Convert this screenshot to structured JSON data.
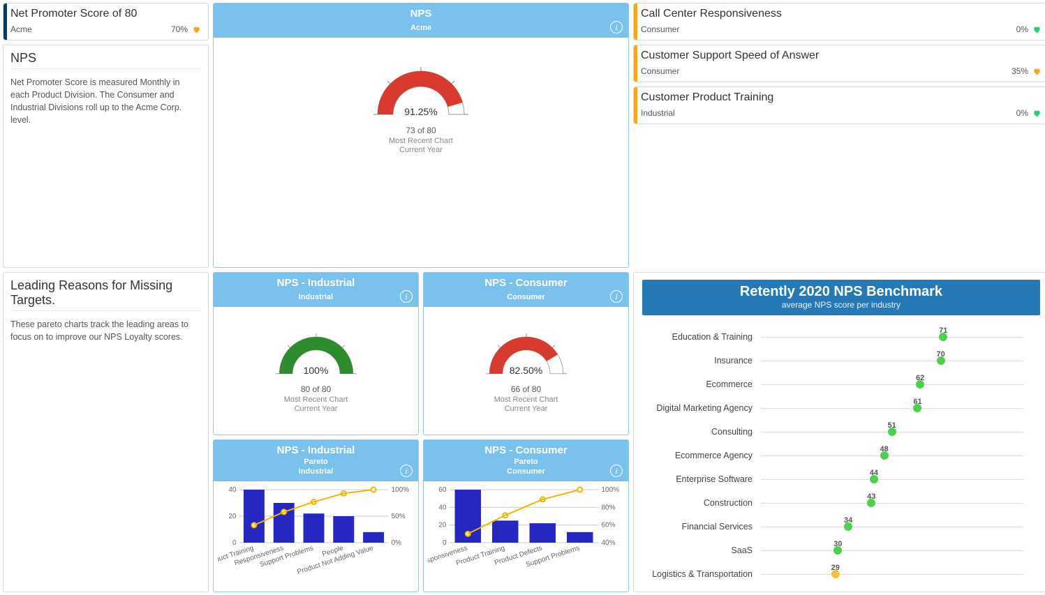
{
  "left": {
    "nps_card": {
      "title": "Net Promoter Score of 80",
      "sub": "Acme",
      "pct": "70%",
      "heart_color": "#f5a623"
    },
    "nps_text": {
      "heading": "NPS",
      "body": "Net Promoter Score is measured Monthly in each Product Division. The Consumer and Industrial Divisions roll up to the Acme Corp. level."
    },
    "reasons_text": {
      "heading": "Leading Reasons for Missing Targets.",
      "body": "These pareto charts track the leading areas to focus on to improve our NPS Loyalty scores."
    }
  },
  "center": {
    "nps_main": {
      "title": "NPS",
      "sub": "Acme",
      "gauge_pct": "91.25%",
      "of_text": "73 of 80",
      "line1": "Most Recent Chart",
      "line2": "Current Year",
      "color": "#d83a2f",
      "value": 91.25
    },
    "nps_ind": {
      "title": "NPS - Industrial",
      "sub": "Industrial",
      "gauge_pct": "100%",
      "of_text": "80 of 80",
      "line1": "Most Recent Chart",
      "line2": "Current Year",
      "color": "#2e8b2e",
      "value": 100
    },
    "nps_con": {
      "title": "NPS - Consumer",
      "sub": "Consumer",
      "gauge_pct": "82.50%",
      "of_text": "66 of 80",
      "line1": "Most Recent Chart",
      "line2": "Current Year",
      "color": "#d83a2f",
      "value": 82.5
    },
    "pareto_ind": {
      "title": "NPS - Industrial",
      "sub1": "Pareto",
      "sub2": "Industrial"
    },
    "pareto_con": {
      "title": "NPS - Consumer",
      "sub1": "Pareto",
      "sub2": "Consumer"
    }
  },
  "right": {
    "cards": [
      {
        "title": "Call Center Responsiveness",
        "sub": "Consumer",
        "pct": "0%",
        "heart_color": "#2ecc71"
      },
      {
        "title": "Customer Support Speed of Answer",
        "sub": "Consumer",
        "pct": "35%",
        "heart_color": "#f5a623"
      },
      {
        "title": "Customer Product Training",
        "sub": "Industrial",
        "pct": "0%",
        "heart_color": "#2ecc71"
      }
    ],
    "bench": {
      "title": "Retently 2020 NPS Benchmark",
      "subtitle": "average NPS score per industry"
    }
  },
  "chart_data": [
    {
      "id": "gauge-acme",
      "type": "gauge",
      "title": "NPS — Acme",
      "value_pct": 91.25,
      "raw": "73 of 80",
      "range": [
        0,
        100
      ],
      "color": "#d83a2f"
    },
    {
      "id": "gauge-industrial",
      "type": "gauge",
      "title": "NPS — Industrial",
      "value_pct": 100,
      "raw": "80 of 80",
      "range": [
        0,
        100
      ],
      "color": "#2e8b2e"
    },
    {
      "id": "gauge-consumer",
      "type": "gauge",
      "title": "NPS — Consumer",
      "value_pct": 82.5,
      "raw": "66 of 80",
      "range": [
        0,
        100
      ],
      "color": "#d83a2f"
    },
    {
      "id": "pareto-industrial",
      "type": "pareto",
      "title": "NPS - Industrial Pareto",
      "categories": [
        "Product Training",
        "Responsiveness",
        "Support Problems",
        "People",
        "Product Not Adding Value"
      ],
      "bars": [
        40,
        30,
        22,
        20,
        8
      ],
      "cum_pct": [
        33,
        58,
        77,
        93,
        100
      ],
      "y_left_ticks": [
        0,
        20,
        40
      ],
      "y_right_ticks": [
        0,
        50,
        100
      ],
      "y_right_suffix": "%"
    },
    {
      "id": "pareto-consumer",
      "type": "pareto",
      "title": "NPS - Consumer Pareto",
      "categories": [
        "Responsiveness",
        "Product Training",
        "Product Defects",
        "Support Problems"
      ],
      "bars": [
        60,
        25,
        22,
        12
      ],
      "cum_pct": [
        50,
        71,
        89,
        100
      ],
      "y_left_ticks": [
        0,
        20,
        40,
        60
      ],
      "y_right_ticks": [
        40,
        60,
        80,
        100
      ],
      "y_right_suffix": "%"
    },
    {
      "id": "benchmark",
      "type": "dotplot",
      "title": "Retently 2020 NPS Benchmark",
      "subtitle": "average NPS score per industry",
      "x_range": [
        0,
        100
      ],
      "series": [
        {
          "name": "Education & Training",
          "value": 71,
          "color": "#4fcf4f"
        },
        {
          "name": "Insurance",
          "value": 70,
          "color": "#4fcf4f"
        },
        {
          "name": "Ecommerce",
          "value": 62,
          "color": "#4fcf4f"
        },
        {
          "name": "Digital Marketing Agency",
          "value": 61,
          "color": "#4fcf4f"
        },
        {
          "name": "Consulting",
          "value": 51,
          "color": "#4fcf4f"
        },
        {
          "name": "Ecommerce Agency",
          "value": 48,
          "color": "#4fcf4f"
        },
        {
          "name": "Enterprise Software",
          "value": 44,
          "color": "#4fcf4f"
        },
        {
          "name": "Construction",
          "value": 43,
          "color": "#4fcf4f"
        },
        {
          "name": "Financial Services",
          "value": 34,
          "color": "#4fcf4f"
        },
        {
          "name": "SaaS",
          "value": 30,
          "color": "#4fcf4f"
        },
        {
          "name": "Logistics & Transportation",
          "value": 29,
          "color": "#f0c040"
        }
      ]
    }
  ]
}
